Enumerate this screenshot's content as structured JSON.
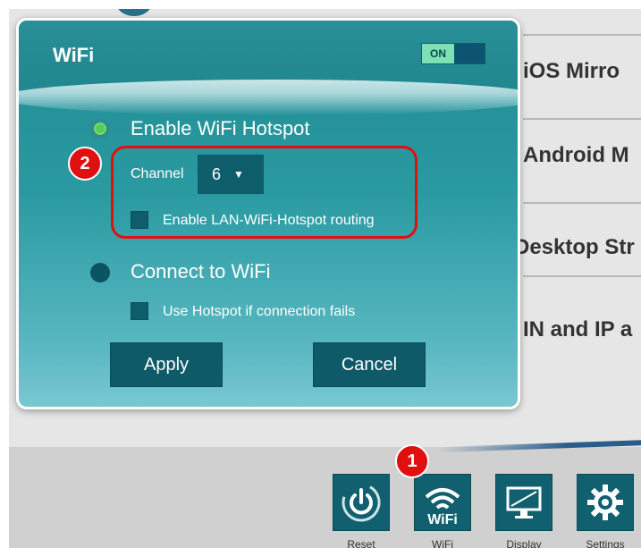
{
  "background": {
    "menu_items": [
      "iOS Mirro",
      "Android M",
      "Desktop Str",
      "IN and IP a"
    ],
    "toolbar": [
      {
        "label": "Reset",
        "icon": "power-icon"
      },
      {
        "label": "WiFi",
        "icon": "wifi-icon"
      },
      {
        "label": "Display",
        "icon": "display-icon"
      },
      {
        "label": "Settings",
        "icon": "gear-icon"
      }
    ]
  },
  "dialog": {
    "title": "WiFi",
    "toggle_label": "ON",
    "options": {
      "hotspot": "Enable WiFi Hotspot",
      "channel_label": "Channel",
      "channel_value": "6",
      "lan_routing": "Enable LAN-WiFi-Hotspot routing",
      "connect": "Connect to WiFi",
      "fallback": "Use Hotspot if connection fails"
    },
    "buttons": {
      "apply": "Apply",
      "cancel": "Cancel"
    }
  },
  "annotations": {
    "badge_1": "1",
    "badge_2": "2"
  },
  "colors": {
    "accent": "#1f8b91",
    "highlight": "#e01010",
    "active_radio": "#55cc55"
  }
}
